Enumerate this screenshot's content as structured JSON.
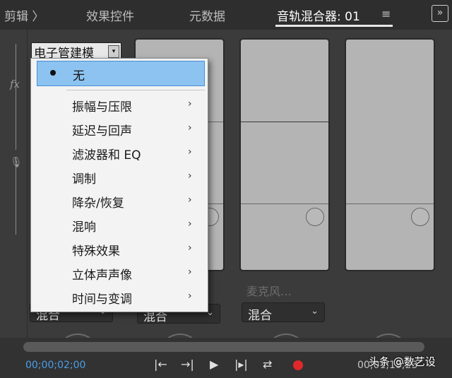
{
  "tabs": {
    "clip": "剪辑 〉",
    "effects": "效果控件",
    "metadata": "元数据",
    "mixer": "音轨混合器: 01",
    "menu_icon": "hamburger-menu-icon",
    "close_icon": "close-icon"
  },
  "rail": {
    "fx_label": "fx",
    "fx_icon": "fx-icon",
    "mic_icon": "microphone-icon"
  },
  "channels": [
    {
      "preset": "电子管建模",
      "send": "",
      "mode": "混合"
    },
    {
      "send": "",
      "mode": "混合"
    },
    {
      "send": "麦克风…",
      "mode": "混合"
    }
  ],
  "popup_menu": {
    "selected": "无",
    "items": [
      "振幅与压限",
      "延迟与回声",
      "滤波器和 EQ",
      "调制",
      "降杂/恢复",
      "混响",
      "特殊效果",
      "立体声声像",
      "时间与变调"
    ]
  },
  "transport": {
    "timecode_current": "00;00;02;00",
    "timecode_total": "00;01;19;23",
    "buttons": [
      "go-to-in-icon",
      "go-to-out-icon",
      "play-icon",
      "play-in-to-out-icon",
      "loop-icon",
      "record-icon"
    ]
  },
  "watermark": "头条 @数艺设",
  "colors": {
    "accent_blue": "#4a9ee8",
    "selection": "#8cc3f0",
    "record": "#e0282a"
  }
}
